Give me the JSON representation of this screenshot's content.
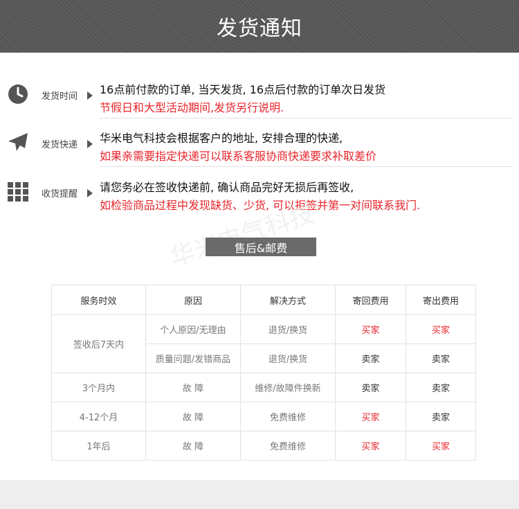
{
  "header": {
    "title": "发货通知"
  },
  "notices": [
    {
      "icon": "clock-icon",
      "label": "发货时间",
      "line1": "16点前付款的订单, 当天发货, 16点后付款的订单次日发货",
      "line2": "节假日和大型活动期间,发货另行说明."
    },
    {
      "icon": "airplane-icon",
      "label": "发货快递",
      "line1": "华米电气科技会根据客户的地址, 安排合理的快递,",
      "line2": "如果亲需要指定快递可以联系客服协商快递要求补取差价"
    },
    {
      "icon": "grid-icon",
      "label": "收货提醒",
      "line1": "请您务必在签收快递前, 确认商品完好无损后再签收,",
      "line2": "如检验商品过程中发现缺货、少货, 可以拒签并第一对间联系我门."
    }
  ],
  "after_sales": {
    "title": "售后&邮费",
    "watermark": "华米电气科技",
    "headers": [
      "服务时效",
      "原因",
      "解决方式",
      "寄回费用",
      "寄出费用"
    ],
    "rows": [
      {
        "period": "签收后7天内",
        "reason": "个人原因/无理由",
        "solution": "退货/换货",
        "return_fee": "买家",
        "send_fee": "买家"
      },
      {
        "period": "签收后7天内",
        "reason": "质量问题/发错商品",
        "solution": "退货/换货",
        "return_fee": "卖家",
        "send_fee": "卖家"
      },
      {
        "period": "3个月内",
        "reason": "故 障",
        "solution": "维修/故障件换新",
        "return_fee": "卖家",
        "send_fee": "卖家"
      },
      {
        "period": "4-12个月",
        "reason": "故 障",
        "solution": "免费维修",
        "return_fee": "买家",
        "send_fee": "卖家"
      },
      {
        "period": "1年后",
        "reason": "故 障",
        "solution": "免费维修",
        "return_fee": "买家",
        "send_fee": "买家"
      }
    ]
  },
  "colors": {
    "accent_red": "#e8252b",
    "header_bg": "#5a5a5a",
    "subtitle_bg": "#6a6a6a"
  }
}
